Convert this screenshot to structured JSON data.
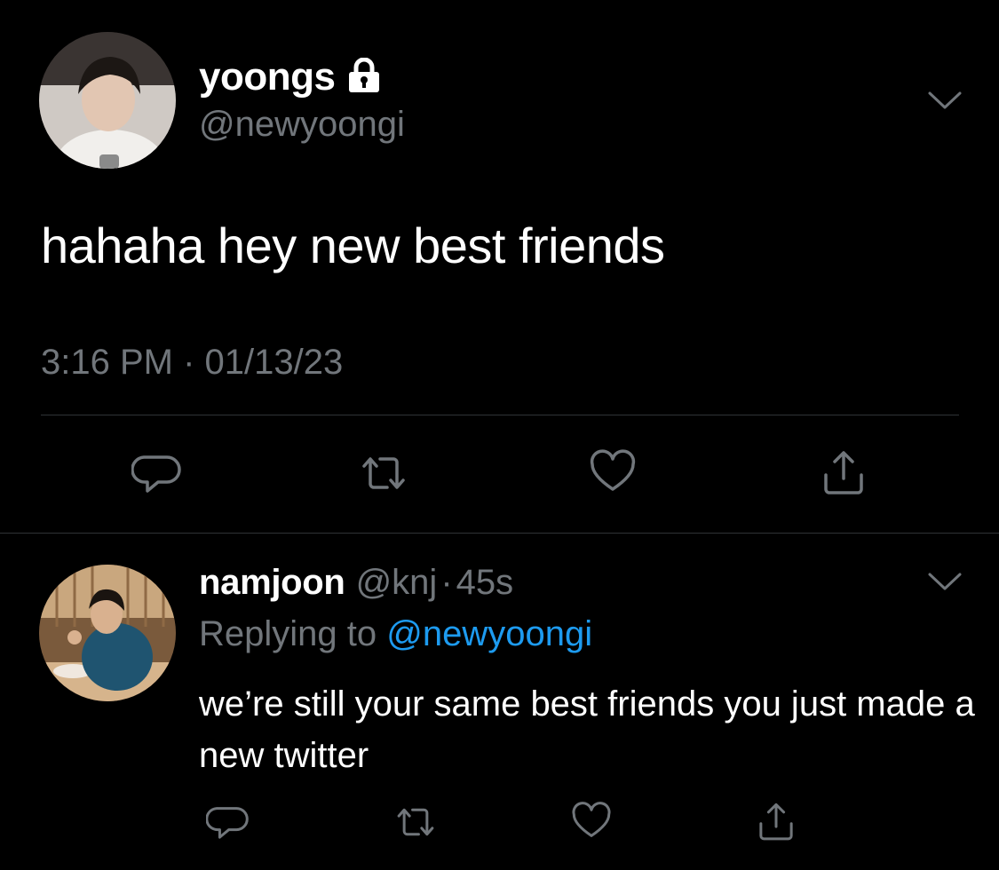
{
  "main_tweet": {
    "display_name": "yoongs",
    "handle": "@newyoongi",
    "text": "hahaha hey new best friends",
    "timestamp": "3:16 PM · 01/13/23",
    "protected_icon": "lock-icon",
    "actions": [
      "reply-icon",
      "retweet-icon",
      "like-icon",
      "share-icon"
    ]
  },
  "reply_tweet": {
    "display_name": "namjoon",
    "handle": "@knj",
    "separator": "·",
    "age": "45s",
    "replying_prefix": "Replying to",
    "replying_to": "@newyoongi",
    "text": "we’re still your same best friends you just made a new twitter",
    "actions": [
      "reply-icon",
      "retweet-icon",
      "like-icon",
      "share-icon"
    ]
  },
  "colors": {
    "background": "#000000",
    "text": "#ffffff",
    "secondary": "#71767b",
    "accent": "#1d9bf0",
    "divider": "#2f3336"
  }
}
